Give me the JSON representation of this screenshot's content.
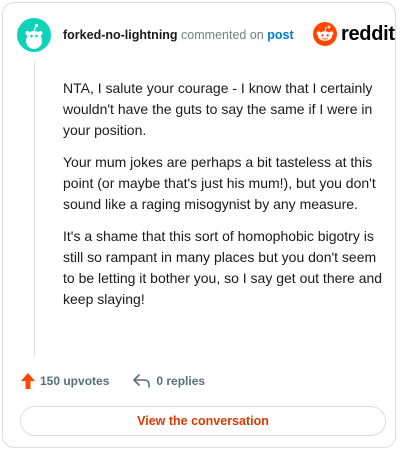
{
  "comment": {
    "username": "forked-no-lightning",
    "commented_on_text": "commented on",
    "post_link_text": "post",
    "paragraphs": [
      "NTA, I salute your courage - I know that I certainly wouldn't have the guts to say the same if I were in your position.",
      "Your mum jokes are perhaps a bit tasteless at this point (or maybe that's just his mum!), but you don't sound like a raging misogynist by any measure.",
      "It's a shame that this sort of homophobic bigotry is still so rampant in many places but you don't seem to be letting it bother you, so I say get out there and keep slaying!"
    ]
  },
  "brand": {
    "wordmark": "reddit",
    "icon": "reddit-snoo-icon",
    "color": "#ff4500"
  },
  "avatar": {
    "icon": "snoo-avatar-icon",
    "color": "#0dd3bb"
  },
  "actions": {
    "upvotes": {
      "label": "150 upvotes",
      "icon": "upvote-arrow-icon",
      "color": "#ff4500"
    },
    "replies": {
      "label": "0 replies",
      "icon": "reply-icon"
    }
  },
  "cta": {
    "label": "View the conversation",
    "color": "#d93a00"
  }
}
